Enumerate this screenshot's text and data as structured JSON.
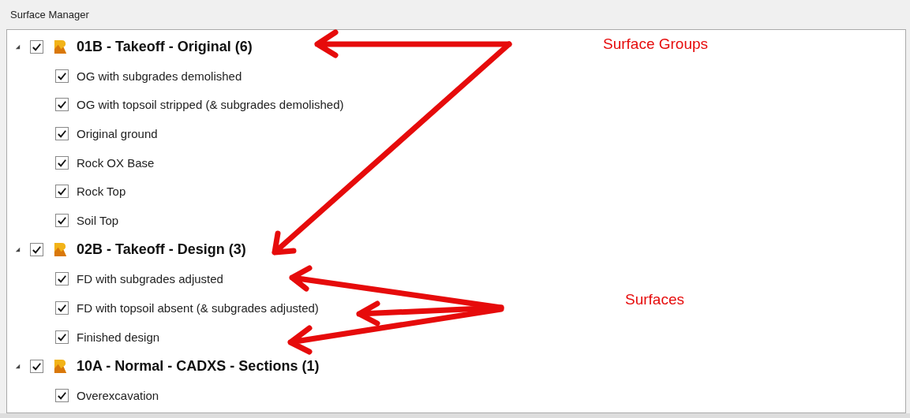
{
  "panel": {
    "title": "Surface Manager"
  },
  "groups": [
    {
      "label": "01B - Takeoff - Original (6)",
      "checked": true,
      "expanded": true,
      "children": [
        {
          "label": "OG with subgrades demolished",
          "checked": true
        },
        {
          "label": "OG with topsoil stripped (& subgrades demolished)",
          "checked": true
        },
        {
          "label": "Original ground",
          "checked": true
        },
        {
          "label": "Rock OX Base",
          "checked": true
        },
        {
          "label": "Rock Top",
          "checked": true
        },
        {
          "label": "Soil Top",
          "checked": true
        }
      ]
    },
    {
      "label": "02B - Takeoff - Design (3)",
      "checked": true,
      "expanded": true,
      "children": [
        {
          "label": "FD with subgrades adjusted",
          "checked": true
        },
        {
          "label": "FD with topsoil absent (& subgrades adjusted)",
          "checked": true
        },
        {
          "label": "Finished design",
          "checked": true
        }
      ]
    },
    {
      "label": "10A - Normal - CADXS - Sections (1)",
      "checked": true,
      "expanded": true,
      "children": [
        {
          "label": "Overexcavation",
          "checked": true
        }
      ]
    }
  ],
  "annotations": [
    {
      "text": "Surface Groups"
    },
    {
      "text": "Surfaces"
    }
  ]
}
